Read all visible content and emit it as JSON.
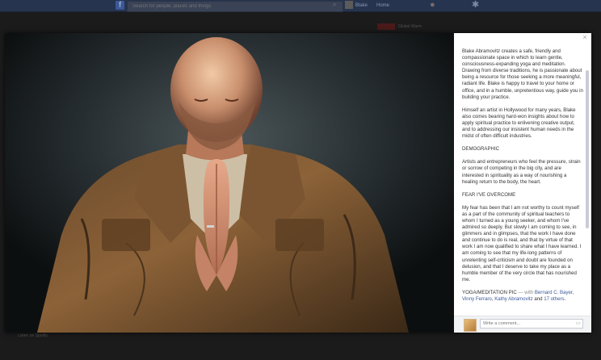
{
  "topbar": {
    "logo": "f",
    "search_placeholder": "Search for people, places and things",
    "profile_name": "Blake",
    "home_label": "Home"
  },
  "background": {
    "left_text": "",
    "right_rows": [
      "",
      "Global Warm"
    ],
    "left_bottom": [
      "",
      "Listen on Spotify"
    ],
    "center_bottom": ""
  },
  "viewer": {
    "description": {
      "p1": "Blake Abramovitz creates a safe, friendly and compassionate space in which to learn gentle, consciousness-expanding yoga and meditation. Drawing from diverse traditions, he is passionate about being a resource for those seeking a more meaningful, radiant life. Blake is happy to travel to your home or office, and in a humble, unpretentious way, guide you in building your practice.",
      "p2": "Himself an artist in Hollywood for many years, Blake also comes bearing hard-won insights about how to apply spiritual practice to enlivening creative output, and to addressing our insistent human needs in the midst of often difficult industries.",
      "h1": "DEMOGRAPHIC",
      "p3": "Artists and entrepreneurs who feel the pressure, strain or sorrow of competing in the big city, and are interested in spirituality as a way of nourishing a healing return to the body, the heart.",
      "h2": "FEAR I'VE OVERCOME",
      "p4": "My fear has been that I am not worthy to count myself as a part of the community of spiritual teachers to whom I turned as a young seeker, and whom I've admired so deeply. But slowly I am coming to see, in glimmers and in glimpses, that the work I have done and continue to do is real, and that by virtue of that work I am now qualified to share what I have learned. I am coming to see that my life-long patterns of unrelenting self-criticism and doubt are founded on delusion, and that I deserve to take my place as a humble member of the very circle that has nourished me.",
      "tag_caption": "YOGA/MEDITATION PIC",
      "tag_with": " — with ",
      "tag_person1": "Bernard C. Bayer",
      "tag_person2": "Vinny Ferraro",
      "tag_person3": "Kathy Abramovitz",
      "tag_and": " and ",
      "tag_others": "17 others",
      "sep": ", ",
      "dot": "."
    },
    "comment": {
      "placeholder": "Write a comment..."
    }
  },
  "icons": {
    "close": "×",
    "camera": "▭",
    "search": "⌕",
    "globe": "●",
    "gear": "✱"
  },
  "colors": {
    "link": "#3b5998",
    "topbar": "#26344f"
  }
}
